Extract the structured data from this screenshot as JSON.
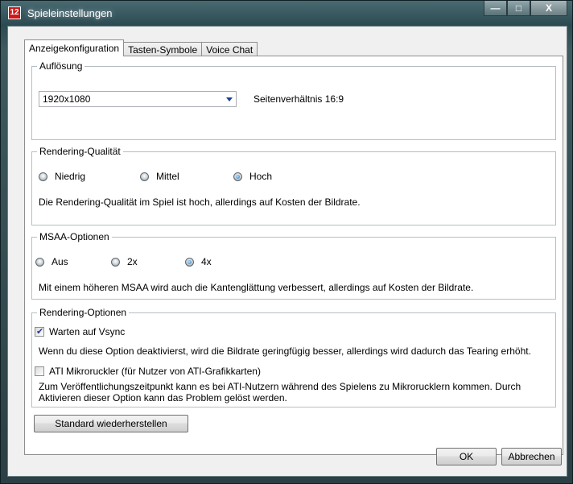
{
  "window": {
    "title": "Spieleinstellungen",
    "icon_text": "12"
  },
  "window_buttons": {
    "minimize": "—",
    "maximize": "□",
    "close": "X"
  },
  "tabs": [
    "Anzeigekonfiguration",
    "Tasten-Symbole",
    "Voice Chat"
  ],
  "resolution": {
    "legend": "Auflösung",
    "selected": "1920x1080",
    "aspect_ratio": "Seitenverhältnis 16:9"
  },
  "rendering_quality": {
    "legend": "Rendering-Qualität",
    "options": [
      "Niedrig",
      "Mittel",
      "Hoch"
    ],
    "selected": "Hoch",
    "description": "Die Rendering-Qualität im Spiel ist hoch, allerdings auf Kosten der Bildrate."
  },
  "msaa": {
    "legend": "MSAA-Optionen",
    "options": [
      "Aus",
      "2x",
      "4x"
    ],
    "selected": "4x",
    "description": "Mit einem höheren MSAA wird auch die Kantenglättung verbessert, allerdings auf Kosten der Bildrate."
  },
  "rendering_options": {
    "legend": "Rendering-Optionen",
    "vsync_label": "Warten auf Vsync",
    "vsync_checked": true,
    "vsync_description": "Wenn du diese Option deaktivierst, wird die Bildrate geringfügig besser, allerdings wird dadurch das Tearing erhöht.",
    "ati_label": "ATI Mikroruckler (für Nutzer von ATI-Grafikkarten)",
    "ati_checked": false,
    "ati_description": "Zum Veröffentlichungszeitpunkt kann es bei ATI-Nutzern während des Spielens zu Mikrorucklern kommen. Durch Aktivieren dieser Option kann das Problem gelöst werden."
  },
  "buttons": {
    "restore_defaults": "Standard wiederherstellen",
    "ok": "OK",
    "cancel": "Abbrechen"
  }
}
